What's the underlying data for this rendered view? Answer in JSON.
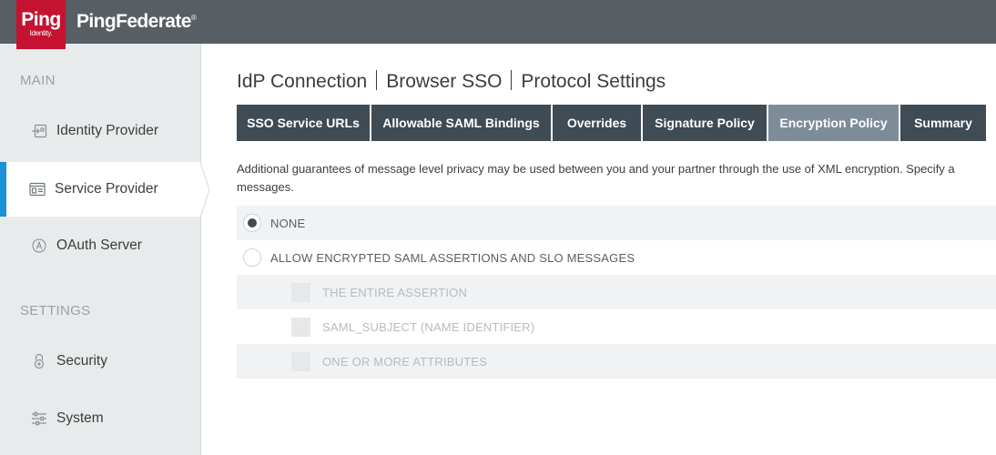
{
  "header": {
    "logo_main": "Ping",
    "logo_sub": "Identity.",
    "product": "PingFederate",
    "product_mark": "®"
  },
  "sidebar": {
    "main_section": "MAIN",
    "settings_section": "SETTINGS",
    "items": [
      {
        "label": "Identity Provider",
        "icon": "identity-provider-icon",
        "active": false
      },
      {
        "label": "Service Provider",
        "icon": "service-provider-icon",
        "active": true
      },
      {
        "label": "OAuth Server",
        "icon": "oauth-icon",
        "active": false
      },
      {
        "label": "Security",
        "icon": "lock-icon",
        "active": false
      },
      {
        "label": "System",
        "icon": "sliders-icon",
        "active": false
      }
    ]
  },
  "breadcrumb": [
    "IdP Connection",
    "Browser SSO",
    "Protocol Settings"
  ],
  "tabs": [
    {
      "label": "SSO Service URLs",
      "selected": false
    },
    {
      "label": "Allowable SAML Bindings",
      "selected": false
    },
    {
      "label": "Overrides",
      "selected": false
    },
    {
      "label": "Signature Policy",
      "selected": false
    },
    {
      "label": "Encryption Policy",
      "selected": true
    },
    {
      "label": "Summary",
      "selected": false
    }
  ],
  "description": {
    "line1": "Additional guarantees of message level privacy may be used between you and your partner through the use of XML encryption. Specify a",
    "line2": "messages."
  },
  "options": {
    "none": {
      "label": "NONE",
      "selected": true
    },
    "allow": {
      "label": "ALLOW ENCRYPTED SAML ASSERTIONS AND SLO MESSAGES",
      "selected": false
    },
    "checkboxes": [
      {
        "label": "THE ENTIRE ASSERTION",
        "checked": false,
        "disabled": true
      },
      {
        "label": "SAML_SUBJECT (NAME IDENTIFIER)",
        "checked": false,
        "disabled": true
      },
      {
        "label": "ONE OR MORE ATTRIBUTES",
        "checked": false,
        "disabled": true
      }
    ]
  },
  "colors": {
    "header_bg": "#575e64",
    "brand_red": "#c41230",
    "tab_bg": "#3f4b55",
    "tab_selected_bg": "#7d8c98",
    "active_accent": "#1a91d8"
  }
}
